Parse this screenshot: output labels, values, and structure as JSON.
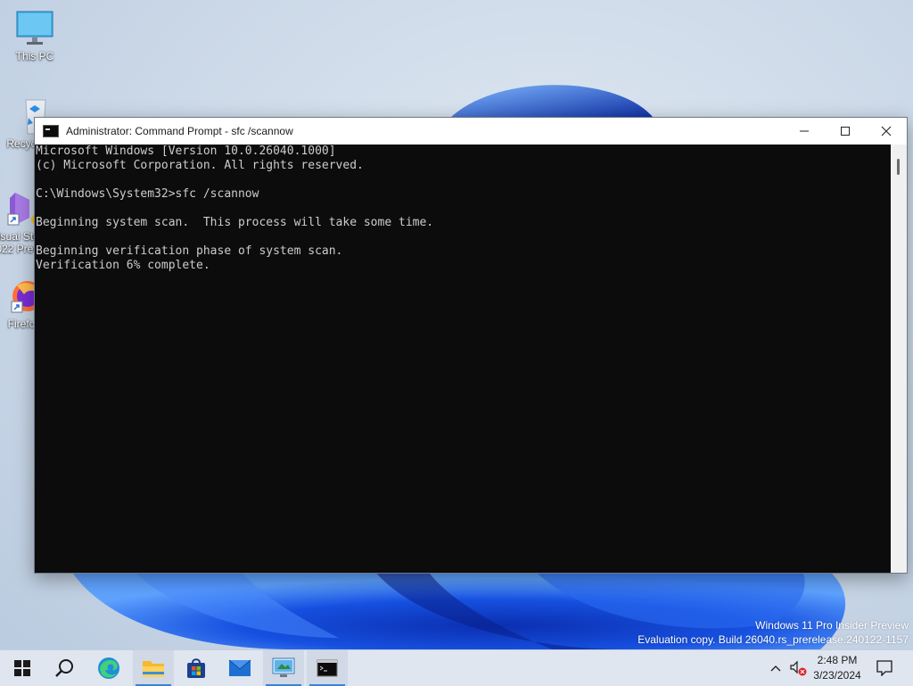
{
  "desktop": {
    "icons": [
      {
        "label": "This PC"
      },
      {
        "label": "Recycle Bin"
      },
      {
        "label": "Visual Studio 2022 Preview"
      },
      {
        "label": "Firefox"
      }
    ]
  },
  "window": {
    "title": "Administrator: Command Prompt - sfc  /scannow",
    "console_lines": [
      "Microsoft Windows [Version 10.0.26040.1000]",
      "(c) Microsoft Corporation. All rights reserved.",
      "",
      "C:\\Windows\\System32>sfc /scannow",
      "",
      "Beginning system scan.  This process will take some time.",
      "",
      "Beginning verification phase of system scan.",
      "Verification 6% complete."
    ]
  },
  "watermark": {
    "line1": "Windows 11 Pro Insider Preview",
    "line2": "Evaluation copy. Build 26040.rs_prerelease.240122-1157"
  },
  "taskbar": {
    "apps": [
      "start-icon",
      "search-icon",
      "edge-icon",
      "file-explorer-icon",
      "store-icon",
      "mail-icon",
      "control-panel-icon",
      "command-prompt-icon"
    ],
    "time": "2:48 PM",
    "date": "3/23/2024"
  },
  "colors": {
    "console_bg": "#0c0c0c",
    "console_fg": "#cccccc",
    "accent": "#3b82d6"
  }
}
